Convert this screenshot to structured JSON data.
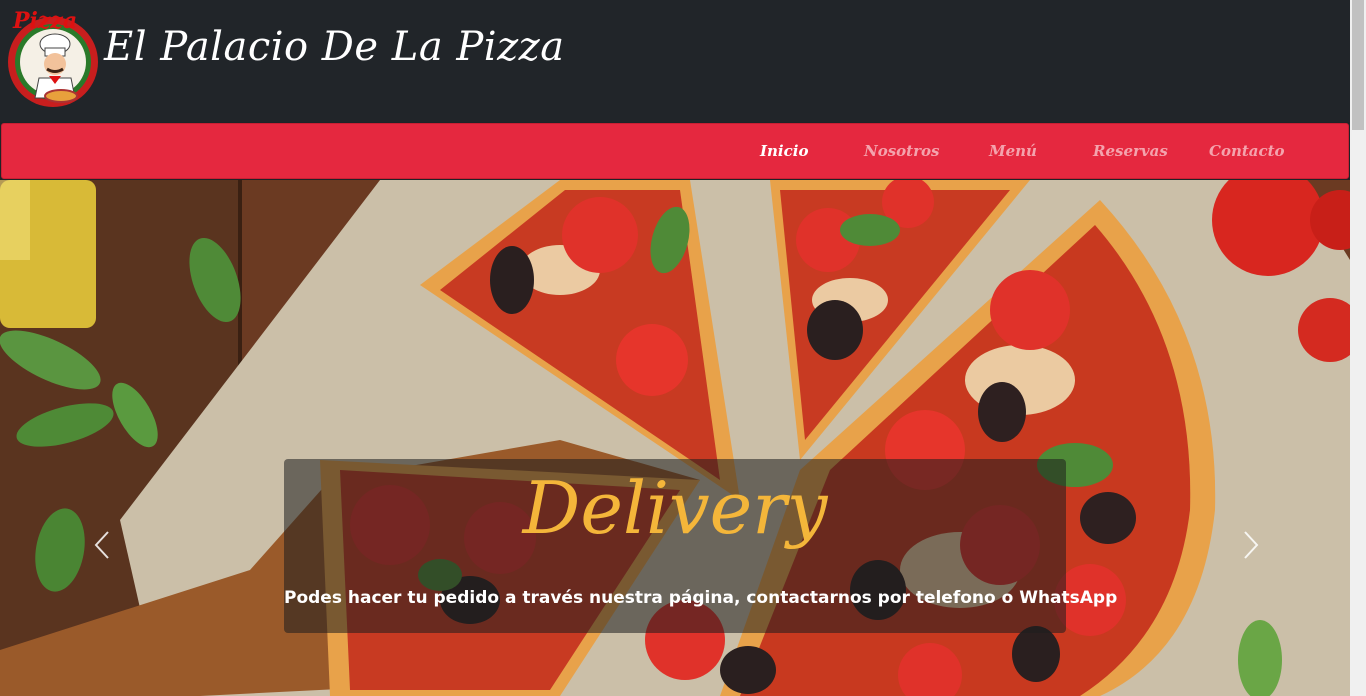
{
  "header": {
    "logo_text": "Pizza",
    "title": "El Palacio De La Pizza"
  },
  "nav": {
    "items": [
      {
        "label": "Inicio",
        "active": true
      },
      {
        "label": "Nosotros",
        "active": false
      },
      {
        "label": "Menú",
        "active": false
      },
      {
        "label": "Reservas",
        "active": false
      },
      {
        "label": "Contacto",
        "active": false
      }
    ]
  },
  "hero": {
    "title": "Delivery",
    "text": "Podes hacer tu pedido a través nuestra página, contactarnos por telefono o WhatsApp",
    "prev_icon": "chevron-left-icon",
    "next_icon": "chevron-right-icon"
  },
  "colors": {
    "header_bg": "#212529",
    "nav_bg": "#e5283f",
    "caption_title": "#f4b63a"
  }
}
